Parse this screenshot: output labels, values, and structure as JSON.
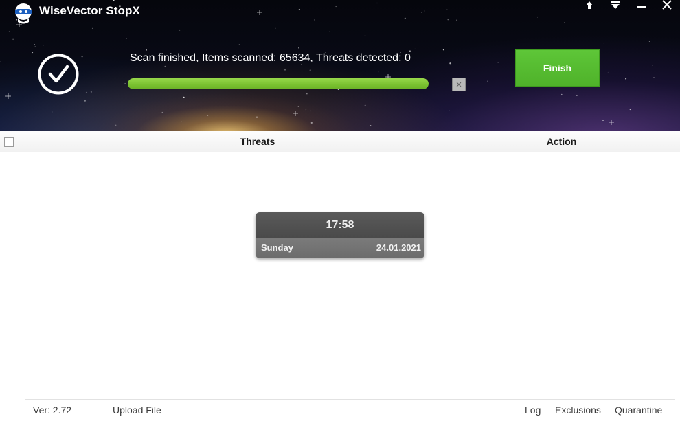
{
  "window": {
    "title": "WiseVector StopX",
    "logo_icon": "robot-mascot-icon",
    "controls": [
      {
        "name": "upload-window-button",
        "icon": "arrow-up-icon"
      },
      {
        "name": "menu-window-button",
        "icon": "menu-down-icon"
      },
      {
        "name": "minimize-window-button",
        "icon": "minimize-icon"
      },
      {
        "name": "close-window-button",
        "icon": "close-icon"
      }
    ]
  },
  "scan": {
    "status_icon": "checkmark-circle-icon",
    "status_text": "Scan finished, Items scanned: 65634, Threats detected: 0",
    "progress_percent": 100,
    "stop_label": "×",
    "finish_label": "Finish",
    "accent_color": "#5ec638"
  },
  "table": {
    "columns": [
      "Threats",
      "Action"
    ],
    "rows": []
  },
  "clock": {
    "time": "17:58",
    "day": "Sunday",
    "date": "24.01.2021"
  },
  "footer": {
    "version": "Ver: 2.72",
    "upload_file": "Upload File",
    "log": "Log",
    "exclusions": "Exclusions",
    "quarantine": "Quarantine"
  }
}
